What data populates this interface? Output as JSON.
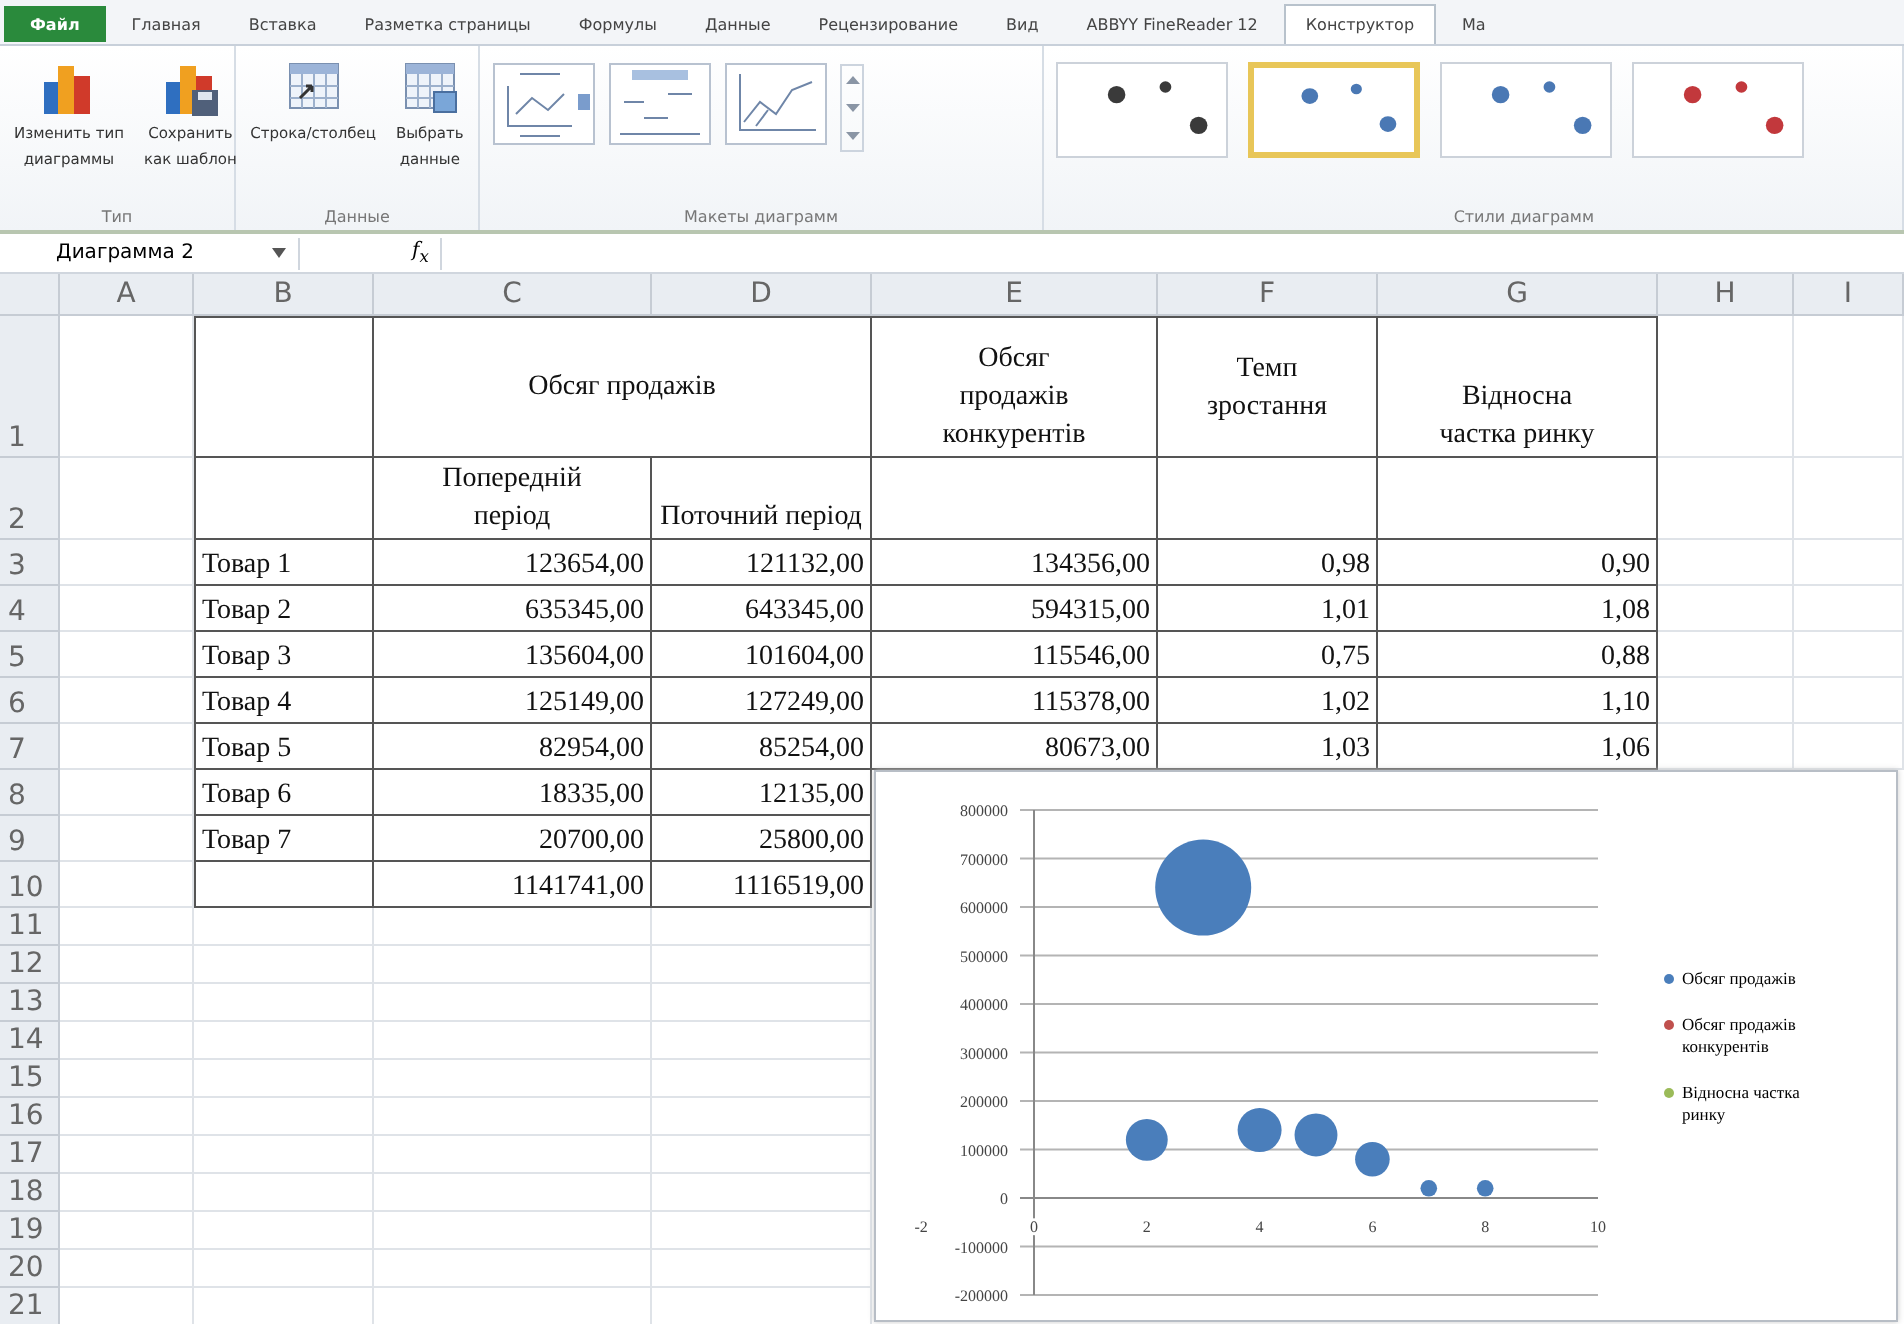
{
  "ribbon": {
    "tabs": [
      {
        "label": "Файл",
        "kind": "file",
        "selected": false
      },
      {
        "label": "Главная",
        "kind": "tab",
        "selected": false
      },
      {
        "label": "Вставка",
        "kind": "tab",
        "selected": false
      },
      {
        "label": "Разметка страницы",
        "kind": "tab",
        "selected": false
      },
      {
        "label": "Формулы",
        "kind": "tab",
        "selected": false
      },
      {
        "label": "Данные",
        "kind": "tab",
        "selected": false
      },
      {
        "label": "Рецензирование",
        "kind": "tab",
        "selected": false
      },
      {
        "label": "Вид",
        "kind": "tab",
        "selected": false
      },
      {
        "label": "ABBYY FineReader 12",
        "kind": "tab",
        "selected": false
      },
      {
        "label": "Конструктор",
        "kind": "tab",
        "selected": true
      },
      {
        "label": "Ма",
        "kind": "tab",
        "selected": false
      }
    ],
    "groups": [
      {
        "label": "Тип",
        "kind": "buttons",
        "buttons": [
          {
            "lines": [
              "Изменить тип",
              "диаграммы"
            ],
            "kind": "change-type"
          },
          {
            "lines": [
              "Сохранить",
              "как шаблон"
            ],
            "kind": "save-template"
          }
        ]
      },
      {
        "label": "Данные",
        "kind": "buttons",
        "buttons": [
          {
            "lines": [
              "Строка/столбец"
            ],
            "kind": "switch"
          },
          {
            "lines": [
              "Выбрать",
              "данные"
            ],
            "kind": "select"
          }
        ]
      },
      {
        "label": "Макеты диаграмм",
        "kind": "layouts",
        "layouts": [
          {
            "kind": "title-legend"
          },
          {
            "kind": "labels"
          },
          {
            "kind": "axes"
          }
        ]
      },
      {
        "label": "Стили диаграмм",
        "kind": "styles",
        "styles": [
          {
            "color": "#3a3a3a",
            "selected": false
          },
          {
            "color": "#4a78b4",
            "selected": true
          },
          {
            "color": "#4a78b4",
            "selected": false
          },
          {
            "color": "#c2383c",
            "selected": false
          }
        ]
      }
    ]
  },
  "formula_bar": {
    "name_box": "Диаграмма 2",
    "function_label": "f$_{x}$"
  },
  "grid": {
    "columns": [
      "A",
      "B",
      "C",
      "D",
      "E",
      "F",
      "G",
      "H",
      "I"
    ],
    "rows": [
      "1",
      "2",
      "3",
      "4",
      "5",
      "6",
      "7",
      "8",
      "9",
      "10",
      "11",
      "12",
      "13",
      "14",
      "15",
      "16",
      "17",
      "18",
      "19",
      "20",
      "21"
    ]
  },
  "table": {
    "sales_header": "Обсяг продажів",
    "previous_header": "Попередній період",
    "current_header": "Поточний період",
    "competitors_header": "Обсяг продажів конкурентів",
    "growth_header": "Темп зростання",
    "share_header": "Відносна частка ринку",
    "rows": [
      {
        "product": "Товар 1",
        "previous": "123654,00",
        "current": "121132,00",
        "competitors": "134356,00",
        "growth": "0,98",
        "share": "0,90"
      },
      {
        "product": "Товар 2",
        "previous": "635345,00",
        "current": "643345,00",
        "competitors": "594315,00",
        "growth": "1,01",
        "share": "1,08"
      },
      {
        "product": "Товар 3",
        "previous": "135604,00",
        "current": "101604,00",
        "competitors": "115546,00",
        "growth": "0,75",
        "share": "0,88"
      },
      {
        "product": "Товар 4",
        "previous": "125149,00",
        "current": "127249,00",
        "competitors": "115378,00",
        "growth": "1,02",
        "share": "1,10"
      },
      {
        "product": "Товар 5",
        "previous": "82954,00",
        "current": "85254,00",
        "competitors": "80673,00",
        "growth": "1,03",
        "share": "1,06"
      },
      {
        "product": "Товар 6",
        "previous": "18335,00",
        "current": "12135,00"
      },
      {
        "product": "Товар 7",
        "previous": "20700,00",
        "current": "25800,00"
      }
    ],
    "totals": {
      "previous": "1141741,00",
      "current": "1116519,00"
    }
  },
  "chart": {
    "chart_data": {
      "type": "scatter",
      "x": [
        2,
        3,
        4,
        5,
        6,
        7,
        8
      ],
      "series": [
        {
          "name": "Обсяг продажів",
          "color": "#4a7ebb",
          "values": [
            120000,
            640000,
            140000,
            130000,
            80000,
            20000,
            20000
          ],
          "sizes": [
            0.19,
            1,
            0.21,
            0.2,
            0.13,
            0.03,
            0.03
          ]
        },
        {
          "name": "Обсяг продажів конкурентів",
          "color": "#c0504d",
          "values": [
            null,
            null,
            null,
            null,
            null,
            null,
            null
          ]
        },
        {
          "name": "Відносна частка ринку",
          "color": "#9bbb59",
          "values": [
            null,
            null,
            null,
            null,
            null,
            null,
            null
          ]
        }
      ],
      "grid": true,
      "xlim": [
        -2,
        10
      ],
      "ylim": [
        -200000,
        800000
      ],
      "xticks": [
        -2,
        0,
        2,
        4,
        6,
        8,
        10
      ],
      "yticks": [
        -200000,
        -100000,
        0,
        100000,
        200000,
        300000,
        400000,
        500000,
        600000,
        700000,
        800000
      ]
    }
  }
}
